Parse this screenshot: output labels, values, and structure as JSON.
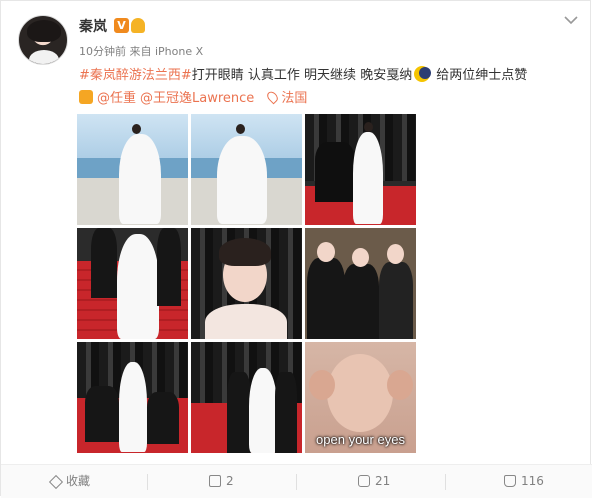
{
  "post": {
    "author": "秦岚",
    "verified_badge": "V",
    "level_badge": "",
    "meta": "10分钟前 来自 iPhone X",
    "hashtag": "#秦岚醉游法兰西#",
    "text": "打开眼睛 认真工作 明天继续 晚安戛纳",
    "closing": "给两位绅士点赞",
    "mentions": [
      "@任重",
      "@王冠逸Lawrence"
    ],
    "location": "法国",
    "image_caption": "open your eyes"
  },
  "actions": {
    "collect": "收藏",
    "forward": "2",
    "comment": "21",
    "like": "116"
  },
  "icons": {
    "menu": "chevron-down-icon",
    "emoji_moon": "moon-emoji-icon",
    "thumb": "thumbs-up-emoji-icon",
    "location": "location-pin-icon"
  },
  "colors": {
    "link": "#eb7350",
    "verified": "#f08a1e",
    "meta_text": "#808080"
  }
}
